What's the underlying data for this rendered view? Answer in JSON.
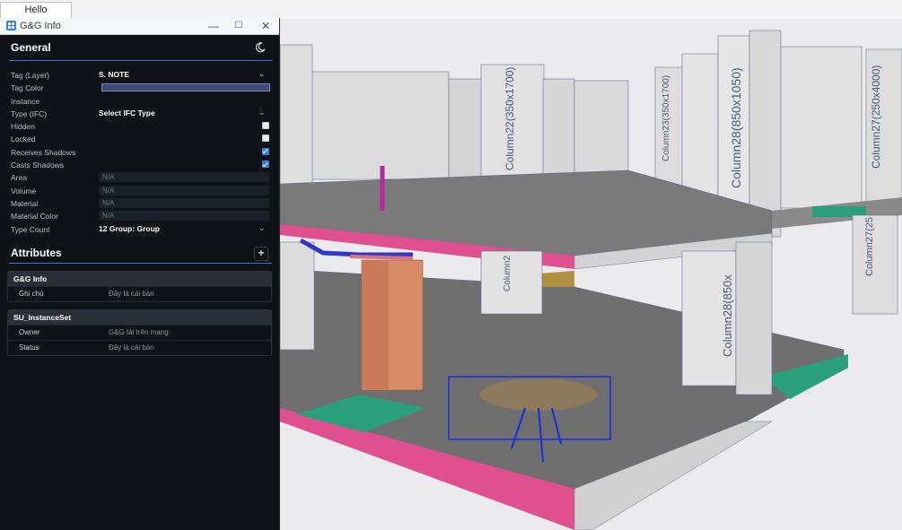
{
  "tab": {
    "label": "Hello"
  },
  "window": {
    "title": "G&G Info",
    "minimize": "—",
    "maximize": "☐",
    "close": "✕"
  },
  "general": {
    "title": "General",
    "fields": {
      "tag_layer": {
        "label": "Tag (Layer)",
        "value": "S. NOTE"
      },
      "tag_color": {
        "label": "Tag Color",
        "color": "#3c4876"
      },
      "instance": {
        "label": "Instance"
      },
      "type_ifc": {
        "label": "Type (IFC)",
        "value": "Select IFC Type"
      },
      "hidden": {
        "label": "Hidden",
        "checked": false
      },
      "locked": {
        "label": "Locked",
        "checked": false
      },
      "receives_shadows": {
        "label": "Receives Shadows",
        "checked": true
      },
      "casts_shadows": {
        "label": "Casts Shadows",
        "checked": true
      },
      "area": {
        "label": "Area",
        "value": "N/A"
      },
      "volume": {
        "label": "Volume",
        "value": "N/A"
      },
      "material": {
        "label": "Material",
        "value": "N/A"
      },
      "material_color": {
        "label": "Material Color",
        "value": "N/A"
      },
      "type_count": {
        "label": "Type Count",
        "value": "12 Group: Group"
      }
    }
  },
  "attributes": {
    "title": "Attributes",
    "add_label": "+",
    "groups": [
      {
        "name": "G&G Info",
        "rows": [
          {
            "key": "Ghi chú",
            "value": "Đây là cái bàn"
          }
        ]
      },
      {
        "name": "SU_InstanceSet",
        "rows": [
          {
            "key": "Owner",
            "value": "G&G tải trên mạng"
          },
          {
            "key": "Status",
            "value": "Đây là cái bàn"
          }
        ]
      }
    ]
  },
  "viewport": {
    "column_labels": [
      "Column22(350x1700)",
      "Column23(350x1700)",
      "Column28(850x1050)",
      "Column27(250x4000)",
      "Column28(850x",
      "Column27(25",
      "Column2"
    ]
  },
  "colors": {
    "accent": "#3c6fd8",
    "panel_bg": "#0f1217",
    "slab_edge": "#e0508f",
    "checkbox_on": "#3a7bd5"
  }
}
